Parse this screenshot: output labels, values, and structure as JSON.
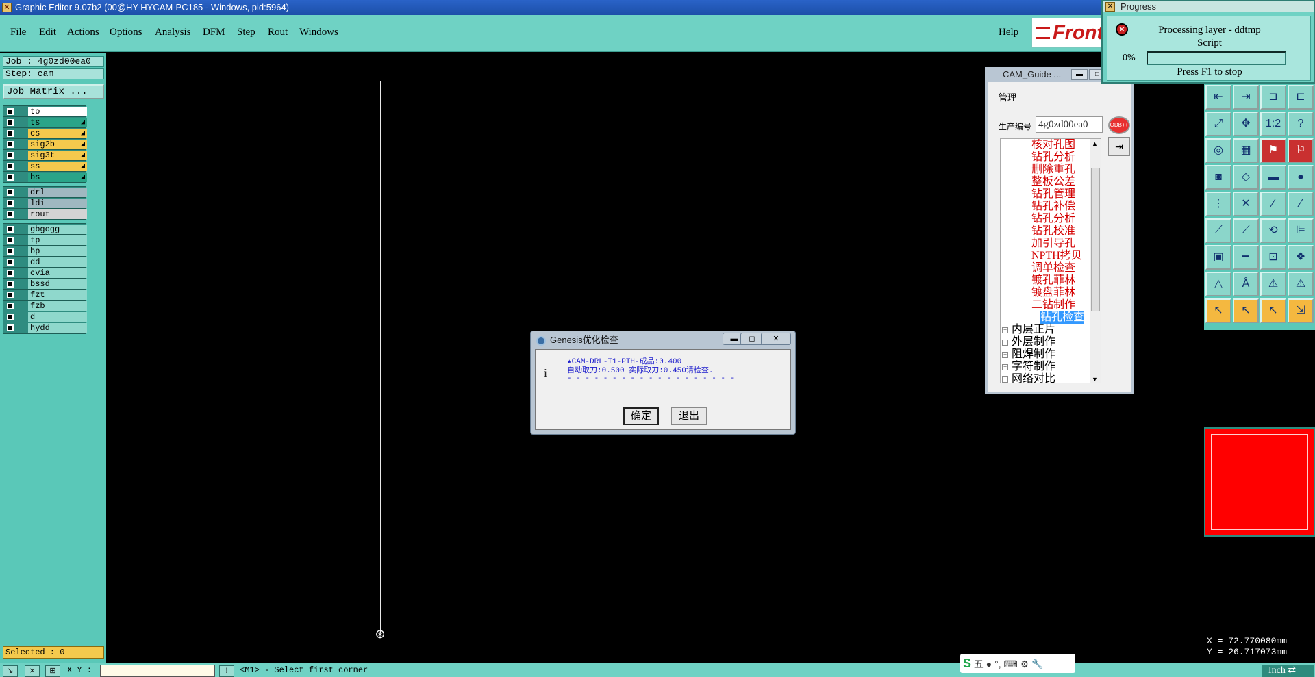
{
  "window": {
    "title": "Graphic Editor 9.07b2 (00@HY-HYCAM-PC185 - Windows, pid:5964)"
  },
  "menu": {
    "items": [
      "File",
      "Edit",
      "Actions",
      "Options",
      "Analysis",
      "DFM",
      "Step",
      "Rout",
      "Windows"
    ],
    "help": "Help",
    "logo_text": "Front"
  },
  "job": {
    "job_label": "Job : 4g0zd00ea0",
    "step_label": "Step: cam",
    "matrix_button": "Job Matrix ..."
  },
  "layers": {
    "group1": [
      {
        "name": "to",
        "color": "#ffffff",
        "arrow": ""
      },
      {
        "name": "ts",
        "color": "#2aa488",
        "arrow": "◢"
      },
      {
        "name": "cs",
        "color": "#f4c94d",
        "arrow": "◢"
      },
      {
        "name": "sig2b",
        "color": "#f4c94d",
        "arrow": "◢"
      },
      {
        "name": "sig3t",
        "color": "#f4c94d",
        "arrow": "◢"
      },
      {
        "name": "ss",
        "color": "#f4c94d",
        "arrow": "◢"
      },
      {
        "name": "bs",
        "color": "#2aa488",
        "arrow": "◢"
      }
    ],
    "group2": [
      {
        "name": "drl",
        "color": "#9fb8c0"
      },
      {
        "name": "ldi",
        "color": "#9fb8c0"
      },
      {
        "name": "rout",
        "color": "#d4d4d4"
      }
    ],
    "group3": [
      {
        "name": "gbgogg",
        "color": "#8fd8cc"
      },
      {
        "name": "tp",
        "color": "#8fd8cc"
      },
      {
        "name": "bp",
        "color": "#8fd8cc"
      },
      {
        "name": "dd",
        "color": "#8fd8cc"
      },
      {
        "name": "cvia",
        "color": "#8fd8cc"
      },
      {
        "name": "bssd",
        "color": "#8fd8cc"
      },
      {
        "name": "fzt",
        "color": "#8fd8cc"
      },
      {
        "name": "fzb",
        "color": "#8fd8cc"
      },
      {
        "name": "d",
        "color": "#8fd8cc"
      },
      {
        "name": "hydd",
        "color": "#8fd8cc"
      }
    ]
  },
  "selected": "Selected : 0",
  "status": {
    "xy_label": "X Y :",
    "prompt": "<M1> - Select first corner",
    "unit": "Inch"
  },
  "coords": {
    "x": "X = 72.770080mm",
    "y": "Y = 26.717073mm"
  },
  "ime": {
    "text": "五 ● °, ⌨ ⚙ 🔧"
  },
  "progress": {
    "title": "Progress",
    "line1": "Processing layer - ddtmp",
    "line2": "Script",
    "percent": "0%",
    "value": 0,
    "hint": "Press F1 to stop"
  },
  "cam_guide": {
    "title": "CAM_Guide ...",
    "manage": "管理",
    "field_label": "生产编号",
    "field_value": "4g0zd00ea0",
    "odb_label": "ODB++",
    "items": [
      "核对孔图",
      "钻孔分析",
      "删除重孔",
      "整板公差",
      "钻孔管理",
      "钻孔补偿",
      "钻孔分析",
      "钻孔校准",
      "加引导孔",
      "NPTH拷贝",
      "调单检查",
      "镀孔菲林",
      "镀盘菲林",
      "二钻制作",
      "钻孔检查"
    ],
    "parents": [
      "内层正片",
      "外层制作",
      "阻焊制作",
      "字符制作",
      "网络对比"
    ]
  },
  "dialog": {
    "title": "Genesis优化检查",
    "line1": "★CAM-DRL-T1-PTH-成品:0.400",
    "line2": "自动取刀:0.500 实际取刀:0.450请检查.",
    "line3": "- - - - - - - - - - - - - - - - - - -",
    "ok": "确定",
    "cancel": "退出"
  },
  "colors": {
    "accent": "#6fd2c4",
    "canvas": "#000000",
    "alert": "#ff0000"
  }
}
